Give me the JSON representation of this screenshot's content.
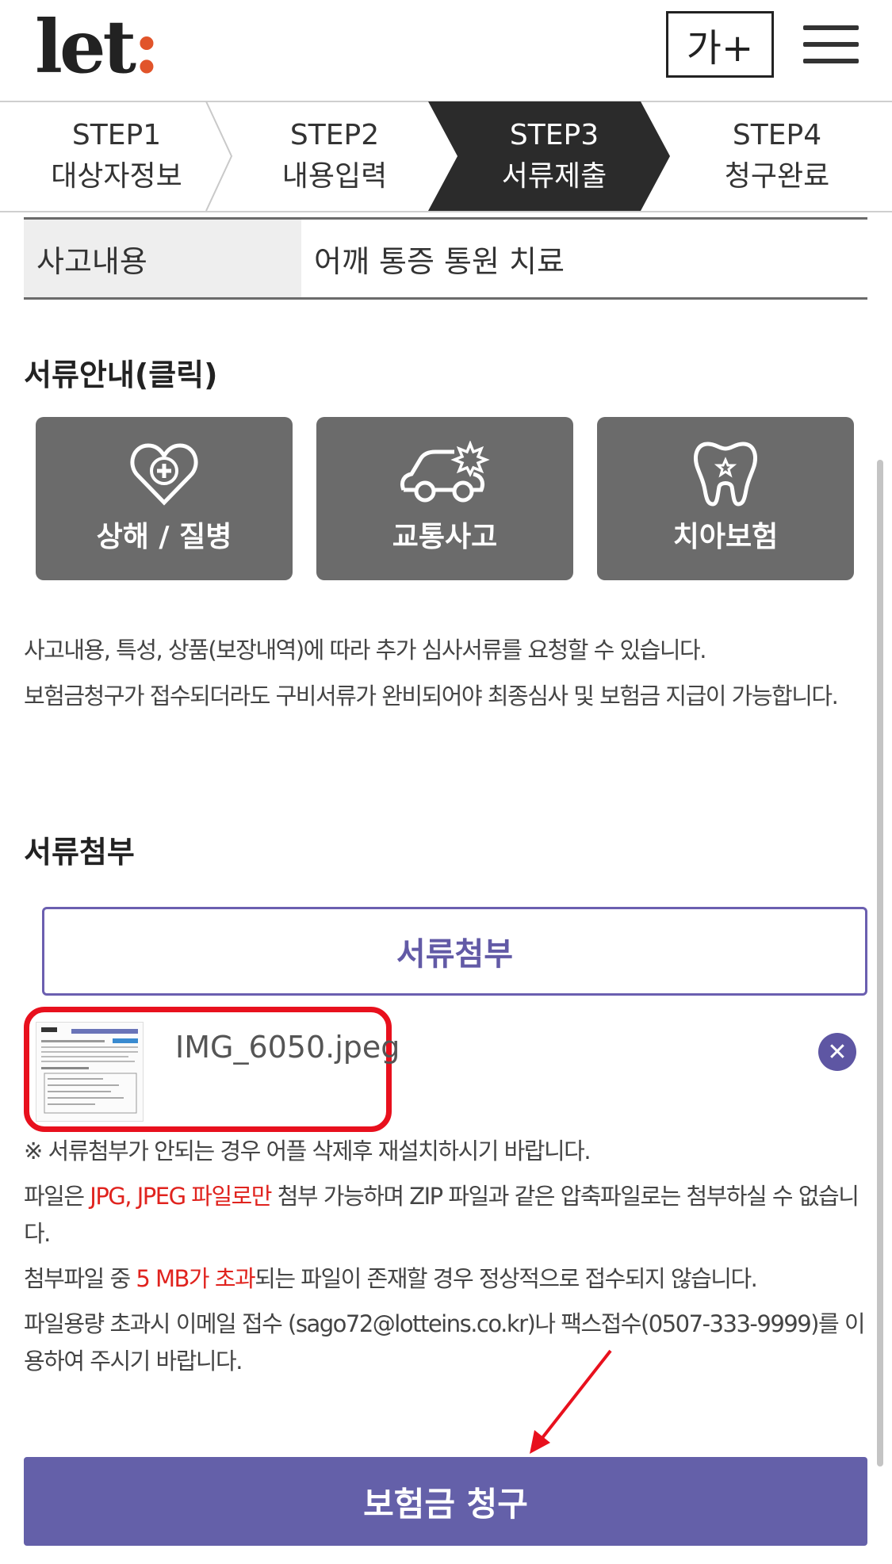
{
  "header": {
    "logo_text": "let",
    "logo_dot": ":",
    "font_size_button": "가+",
    "menu_icon": "hamburger-menu-icon"
  },
  "steps": [
    {
      "step": "STEP1",
      "label": "대상자정보",
      "active": false
    },
    {
      "step": "STEP2",
      "label": "내용입력",
      "active": false
    },
    {
      "step": "STEP3",
      "label": "서류제출",
      "active": true
    },
    {
      "step": "STEP4",
      "label": "청구완료",
      "active": false
    }
  ],
  "accident": {
    "label": "사고내용",
    "value": "어깨 통증 통원 치료"
  },
  "doc_guide": {
    "title": "서류안내(클릭)",
    "buttons": [
      {
        "label": "상해 / 질병",
        "icon": "heart-plus-icon"
      },
      {
        "label": "교통사고",
        "icon": "car-crash-icon"
      },
      {
        "label": "치아보험",
        "icon": "tooth-icon"
      }
    ]
  },
  "notice1": {
    "line1": "사고내용, 특성, 상품(보장내역)에 따라 추가 심사서류를 요청할 수 있습니다.",
    "line2": "보험금청구가 접수되더라도 구비서류가 완비되어야 최종심사 및 보험금 지급이 가능합니다."
  },
  "attach": {
    "title": "서류첨부",
    "button_label": "서류첨부",
    "file": {
      "name": "IMG_6050.jpeg",
      "remove_icon": "close-icon"
    }
  },
  "notice2": {
    "line1": "※ 서류첨부가 안되는 경우 어플 삭제후 재설치하시기 바랍니다.",
    "line2_pre": "파일은 ",
    "line2_red": "JPG, JPEG 파일로만",
    "line2_post": " 첨부 가능하며 ZIP 파일과 같은 압축파일로는 첨부하실 수 없습니다.",
    "line3_pre": "첨부파일 중 ",
    "line3_red": "5 MB가 초과",
    "line3_post": "되는 파일이 존재할 경우 정상적으로 접수되지 않습니다.",
    "line4": "파일용량 초과시 이메일 접수 (sago72@lotteins.co.kr)나 팩스접수(0507-333-9999)를 이용하여 주시기 바랍니다."
  },
  "submit": {
    "label": "보험금 청구"
  },
  "colors": {
    "accent": "#6460a9",
    "logo_dot": "#e1542a",
    "highlight": "#e8101d",
    "step_active": "#2b2b2b",
    "doc_button": "#6b6b6b"
  }
}
